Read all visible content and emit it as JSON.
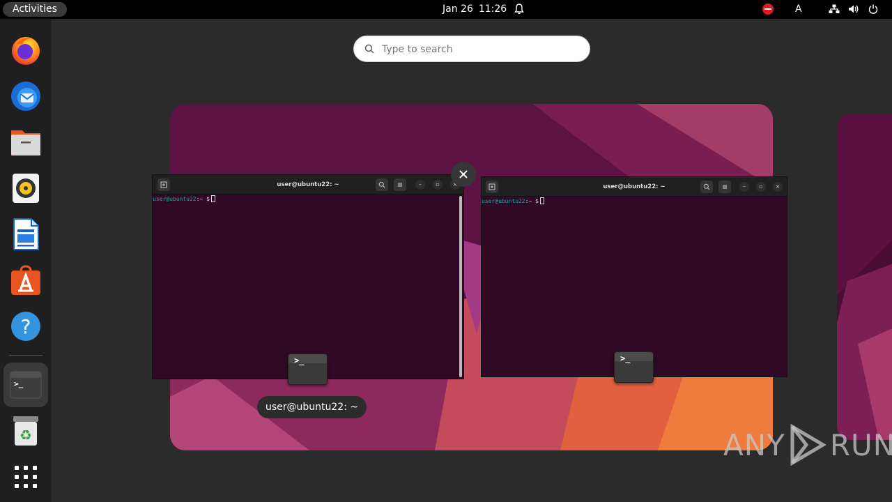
{
  "topbar": {
    "activities_label": "Activities",
    "date": "Jan 26",
    "time": "11:26",
    "keyboard_layout": "A"
  },
  "search": {
    "placeholder": "Type to search"
  },
  "dock": {
    "items": [
      {
        "name": "Firefox",
        "icon": "firefox-icon"
      },
      {
        "name": "Thunderbird",
        "icon": "thunderbird-icon"
      },
      {
        "name": "Files",
        "icon": "files-icon"
      },
      {
        "name": "Rhythmbox",
        "icon": "rhythmbox-icon"
      },
      {
        "name": "LibreOffice Writer",
        "icon": "writer-icon"
      },
      {
        "name": "Ubuntu Software",
        "icon": "software-icon"
      },
      {
        "name": "Help",
        "icon": "help-icon"
      },
      {
        "name": "Terminal",
        "icon": "terminal-icon",
        "running": true
      },
      {
        "name": "Trash",
        "icon": "trash-icon"
      },
      {
        "name": "Show Applications",
        "icon": "app-grid-icon"
      }
    ]
  },
  "windows": [
    {
      "title": "user@ubuntu22: ~",
      "prompt_user": "user@ubuntu22",
      "prompt_path": ":~",
      "prompt_symbol": "$"
    },
    {
      "title": "user@ubuntu22: ~",
      "prompt_user": "user@ubuntu22",
      "prompt_path": ":~",
      "prompt_symbol": "$"
    }
  ],
  "app_icon_text": ">_",
  "hover_caption": "user@ubuntu22: ~",
  "watermark": {
    "left": "ANY",
    "right": "RUN"
  },
  "colors": {
    "terminal_bg": "#300a24",
    "accent": "#e95420",
    "prompt_user": "#27a09a"
  }
}
